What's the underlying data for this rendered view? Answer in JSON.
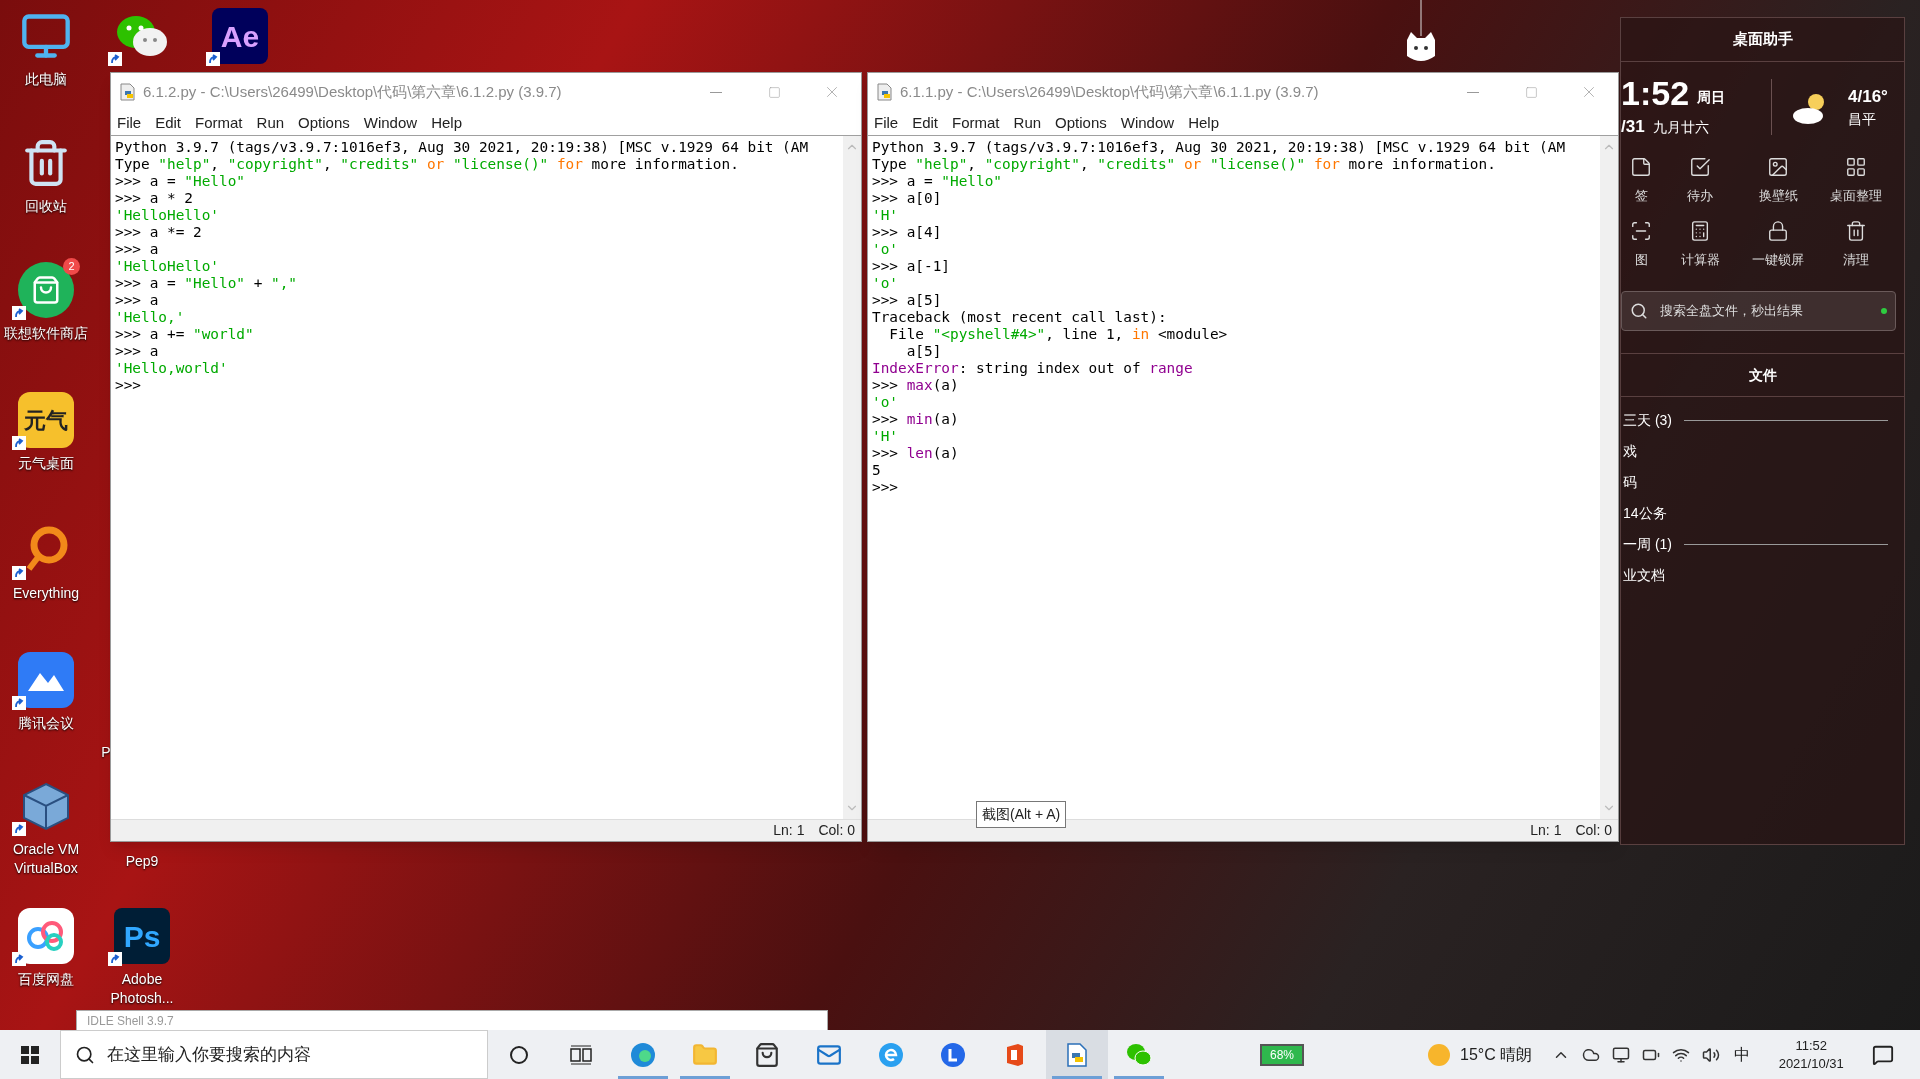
{
  "desktop_icons": [
    {
      "kind": "pc",
      "label": "此电脑",
      "shortcut": false
    },
    {
      "kind": "recycle",
      "label": "回收站",
      "shortcut": false
    },
    {
      "kind": "store",
      "label": "联想软件商店",
      "shortcut": true,
      "badge": "2"
    },
    {
      "kind": "yuanqi",
      "label": "元气桌面",
      "shortcut": true,
      "icon_text": "元气"
    },
    {
      "kind": "everything",
      "label": "Everything",
      "shortcut": true
    },
    {
      "kind": "meeting",
      "label": "腾讯会议",
      "shortcut": true
    },
    {
      "kind": "virtualbox",
      "label": "Oracle VM VirtualBox",
      "shortcut": true
    },
    {
      "kind": "baidu",
      "label": "百度网盘",
      "shortcut": true
    },
    {
      "kind": "wechat",
      "shortcut": true
    },
    {
      "kind": "ae",
      "shortcut": true,
      "icon_text": "Ae"
    },
    {
      "kind": "none",
      "label": "P"
    },
    {
      "kind": "none",
      "label": "Pep9"
    },
    {
      "kind": "ps",
      "label": "Adobe Photosh...",
      "shortcut": true,
      "icon_text": "Ps"
    }
  ],
  "windows": [
    {
      "title": "6.1.2.py - C:\\Users\\26499\\Desktop\\代码\\第六章\\6.1.2.py (3.9.7)",
      "menu": [
        "File",
        "Edit",
        "Format",
        "Run",
        "Options",
        "Window",
        "Help"
      ],
      "lines": [
        [
          {
            "t": "Python 3.9.7 (tags/v3.9.7:1016ef3, Aug 30 2021, 20:19:38) [MSC v.1929 64 bit (AM",
            "kind": "plain"
          }
        ],
        [
          {
            "t": "Type ",
            "kind": "plain"
          },
          {
            "t": "\"help\"",
            "kind": "string"
          },
          {
            "t": ", ",
            "kind": "plain"
          },
          {
            "t": "\"copyright\"",
            "kind": "string"
          },
          {
            "t": ", ",
            "kind": "plain"
          },
          {
            "t": "\"credits\"",
            "kind": "string"
          },
          {
            "t": " or ",
            "kind": "keyword"
          },
          {
            "t": "\"license()\"",
            "kind": "string"
          },
          {
            "t": " for",
            "kind": "keyword"
          },
          {
            "t": " more information.",
            "kind": "plain"
          }
        ],
        [
          {
            "t": ">>> a = ",
            "kind": "plain"
          },
          {
            "t": "\"Hello\"",
            "kind": "string"
          }
        ],
        [
          {
            "t": ">>> a * 2",
            "kind": "plain"
          }
        ],
        [
          {
            "t": "'HelloHello'",
            "kind": "string"
          }
        ],
        [
          {
            "t": ">>> a *= 2",
            "kind": "plain"
          }
        ],
        [
          {
            "t": ">>> a",
            "kind": "plain"
          }
        ],
        [
          {
            "t": "'HelloHello'",
            "kind": "string"
          }
        ],
        [
          {
            "t": ">>> a = ",
            "kind": "plain"
          },
          {
            "t": "\"Hello\"",
            "kind": "string"
          },
          {
            "t": " + ",
            "kind": "plain"
          },
          {
            "t": "\",\"",
            "kind": "string"
          }
        ],
        [
          {
            "t": ">>> a",
            "kind": "plain"
          }
        ],
        [
          {
            "t": "'Hello,'",
            "kind": "string"
          }
        ],
        [
          {
            "t": ">>> a += ",
            "kind": "plain"
          },
          {
            "t": "\"world\"",
            "kind": "string"
          }
        ],
        [
          {
            "t": ">>> a",
            "kind": "plain"
          }
        ],
        [
          {
            "t": "'Hello,world'",
            "kind": "string"
          }
        ],
        [
          {
            "t": ">>>",
            "kind": "plain"
          }
        ]
      ],
      "status": [
        "Ln: 1",
        "Col: 0"
      ]
    },
    {
      "title": "6.1.1.py - C:\\Users\\26499\\Desktop\\代码\\第六章\\6.1.1.py (3.9.7)",
      "menu": [
        "File",
        "Edit",
        "Format",
        "Run",
        "Options",
        "Window",
        "Help"
      ],
      "lines": [
        [
          {
            "t": "Python 3.9.7 (tags/v3.9.7:1016ef3, Aug 30 2021, 20:19:38) [MSC v.1929 64 bit (AM",
            "kind": "plain"
          }
        ],
        [
          {
            "t": "Type ",
            "kind": "plain"
          },
          {
            "t": "\"help\"",
            "kind": "string"
          },
          {
            "t": ", ",
            "kind": "plain"
          },
          {
            "t": "\"copyright\"",
            "kind": "string"
          },
          {
            "t": ", ",
            "kind": "plain"
          },
          {
            "t": "\"credits\"",
            "kind": "string"
          },
          {
            "t": " or ",
            "kind": "keyword"
          },
          {
            "t": "\"license()\"",
            "kind": "string"
          },
          {
            "t": " for",
            "kind": "keyword"
          },
          {
            "t": " more information.",
            "kind": "plain"
          }
        ],
        [
          {
            "t": ">>> a = ",
            "kind": "plain"
          },
          {
            "t": "\"Hello\"",
            "kind": "string"
          }
        ],
        [
          {
            "t": ">>> a[0]",
            "kind": "plain"
          }
        ],
        [
          {
            "t": "'H'",
            "kind": "string"
          }
        ],
        [
          {
            "t": ">>> a[4]",
            "kind": "plain"
          }
        ],
        [
          {
            "t": "'o'",
            "kind": "string"
          }
        ],
        [
          {
            "t": ">>> a[-1]",
            "kind": "plain"
          }
        ],
        [
          {
            "t": "'o'",
            "kind": "string"
          }
        ],
        [
          {
            "t": ">>> a[5]",
            "kind": "plain"
          }
        ],
        [
          {
            "t": "Traceback (most recent call last):",
            "kind": "plain"
          }
        ],
        [
          {
            "t": "  File ",
            "kind": "plain"
          },
          {
            "t": "\"<pyshell#4>\"",
            "kind": "string"
          },
          {
            "t": ", line 1, ",
            "kind": "plain"
          },
          {
            "t": "in",
            "kind": "keyword"
          },
          {
            "t": " <module>",
            "kind": "plain"
          }
        ],
        [
          {
            "t": "    a[5]",
            "kind": "plain"
          }
        ],
        [
          {
            "t": "IndexError",
            "kind": "builtin"
          },
          {
            "t": ": string index out of ",
            "kind": "plain"
          },
          {
            "t": "range",
            "kind": "builtin"
          }
        ],
        [
          {
            "t": ">>> ",
            "kind": "plain"
          },
          {
            "t": "max",
            "kind": "builtin"
          },
          {
            "t": "(a)",
            "kind": "plain"
          }
        ],
        [
          {
            "t": "'o'",
            "kind": "string"
          }
        ],
        [
          {
            "t": ">>> ",
            "kind": "plain"
          },
          {
            "t": "min",
            "kind": "builtin"
          },
          {
            "t": "(a)",
            "kind": "plain"
          }
        ],
        [
          {
            "t": "'H'",
            "kind": "string"
          }
        ],
        [
          {
            "t": ">>> ",
            "kind": "plain"
          },
          {
            "t": "len",
            "kind": "builtin"
          },
          {
            "t": "(a)",
            "kind": "plain"
          }
        ],
        [
          {
            "t": "5",
            "kind": "plain"
          }
        ],
        [
          {
            "t": ">>>",
            "kind": "plain"
          }
        ]
      ],
      "status": [
        "Ln: 1",
        "Col: 0"
      ]
    }
  ],
  "tooltip": "截图(Alt + A)",
  "background_window": {
    "title": "IDLE Shell 3.9.7"
  },
  "widget": {
    "title": "桌面助手",
    "time": "1:52",
    "weekday": "周日",
    "date": "/31",
    "lunar_date": "九月廿六",
    "temperature": "4/16°",
    "city": "昌平",
    "tools": [
      {
        "kind": "note",
        "label": "签"
      },
      {
        "kind": "todo",
        "label": "待办"
      },
      {
        "kind": "wallpaper",
        "label": "换壁纸"
      },
      {
        "kind": "organize",
        "label": "桌面整理"
      },
      {
        "kind": "screenshot",
        "label": "图"
      },
      {
        "kind": "calculator",
        "label": "计算器"
      },
      {
        "kind": "lock",
        "label": "一键锁屏"
      },
      {
        "kind": "clean",
        "label": "清理"
      }
    ],
    "search": {
      "placeholder": "搜索全盘文件，秒出结果"
    },
    "files_title": "文件",
    "files": [
      {
        "kind": "group",
        "label": "三天 (3)"
      },
      {
        "kind": "item",
        "label": "戏"
      },
      {
        "kind": "item",
        "label": "码"
      },
      {
        "kind": "item",
        "label": "14公务"
      },
      {
        "kind": "group",
        "label": "一周 (1)"
      },
      {
        "kind": "item",
        "label": "业文档"
      }
    ]
  },
  "taskbar": {
    "search": {
      "placeholder": "在这里输入你要搜索的内容"
    },
    "apps": [
      {
        "kind": "edge",
        "open": true,
        "selected": false
      },
      {
        "kind": "explorer",
        "open": true,
        "selected": false
      },
      {
        "kind": "store",
        "open": false,
        "selected": false
      },
      {
        "kind": "mail",
        "open": false,
        "selected": false
      },
      {
        "kind": "browser",
        "open": false,
        "selected": false
      },
      {
        "kind": "l-app",
        "open": false,
        "selected": false
      },
      {
        "kind": "office",
        "open": false,
        "selected": false
      },
      {
        "kind": "idle",
        "open": true,
        "selected": true
      },
      {
        "kind": "wechat",
        "open": true,
        "selected": false
      }
    ],
    "battery_badge": "68%",
    "weather": "15°C 晴朗",
    "ime": "中",
    "time": "11:52",
    "date": "2021/10/31"
  }
}
